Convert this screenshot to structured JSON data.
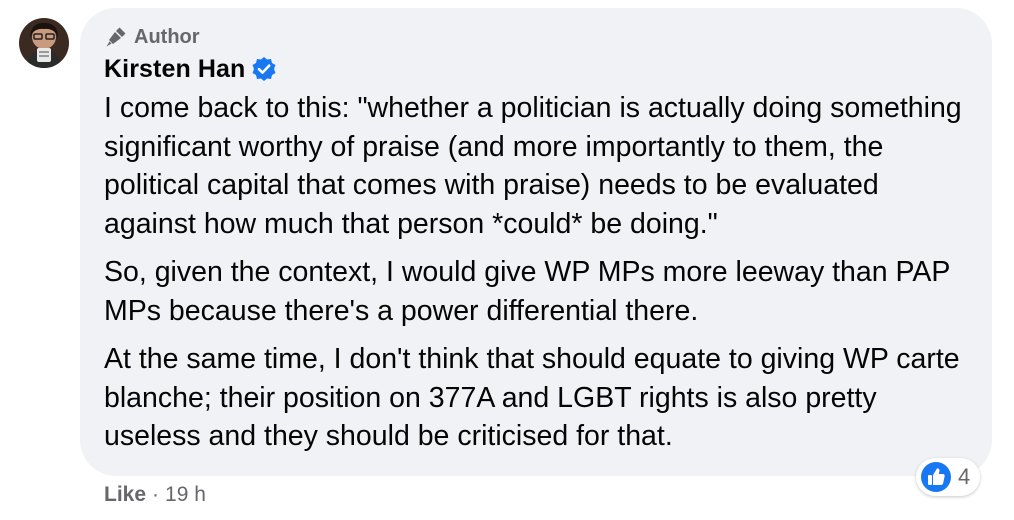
{
  "comment": {
    "author_badge": "Author",
    "author_name": "Kirsten Han",
    "paragraphs": [
      "I come back to this: \"whether a politician is actually doing something significant worthy of praise (and more importantly to them, the political capital that comes with praise) needs to be evaluated against how much that person *could* be doing.\"",
      "So, given the context, I would give WP MPs more leeway than PAP MPs because there's a power differential there.",
      "At the same time, I don't think that should equate to giving WP carte blanche; their position on 377A and LGBT rights is also pretty useless and they should be criticised for that."
    ],
    "reaction_count": "4",
    "like_label": "Like",
    "separator": "·",
    "timestamp": "19 h"
  },
  "icons": {
    "avatar": "avatar",
    "author_badge": "microphone-icon",
    "verified": "verified-badge-icon",
    "reaction": "like-reaction-icon"
  },
  "colors": {
    "bubble": "#f0f2f5",
    "text": "#050505",
    "secondary": "#65676b",
    "brand_blue": "#1877f2"
  }
}
